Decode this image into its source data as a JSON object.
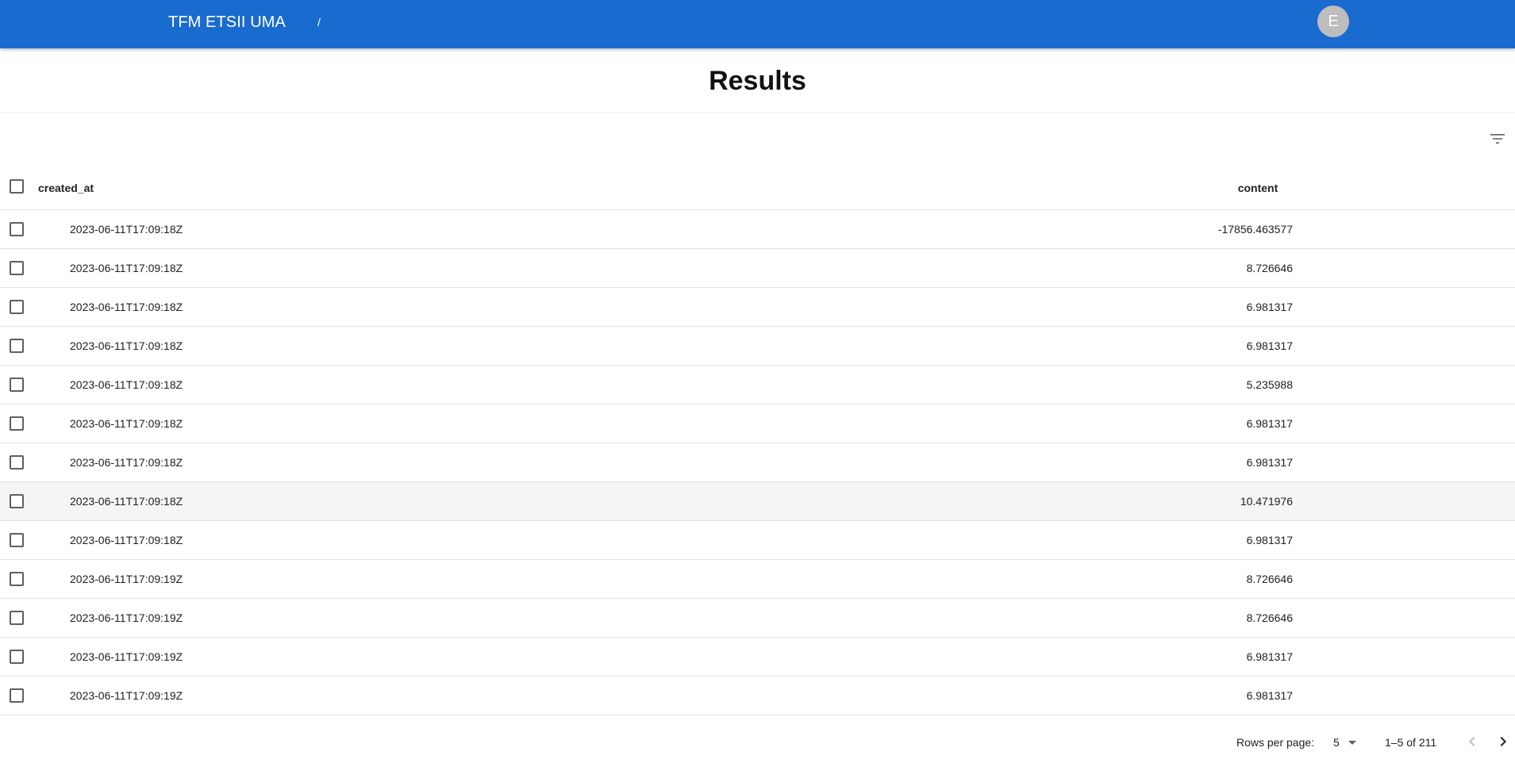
{
  "appbar": {
    "title": "TFM ETSII UMA",
    "breadcrumb_separator": "/",
    "avatar_initial": "E",
    "color": "#1a6bcf"
  },
  "page": {
    "title": "Results"
  },
  "table": {
    "columns": [
      "created_at",
      "content"
    ],
    "rows": [
      {
        "created_at": "2023-06-11T17:09:18Z",
        "content": "-17856.463577"
      },
      {
        "created_at": "2023-06-11T17:09:18Z",
        "content": "8.726646"
      },
      {
        "created_at": "2023-06-11T17:09:18Z",
        "content": "6.981317"
      },
      {
        "created_at": "2023-06-11T17:09:18Z",
        "content": "6.981317"
      },
      {
        "created_at": "2023-06-11T17:09:18Z",
        "content": "5.235988"
      },
      {
        "created_at": "2023-06-11T17:09:18Z",
        "content": "6.981317"
      },
      {
        "created_at": "2023-06-11T17:09:18Z",
        "content": "6.981317"
      },
      {
        "created_at": "2023-06-11T17:09:18Z",
        "content": "10.471976"
      },
      {
        "created_at": "2023-06-11T17:09:18Z",
        "content": "6.981317"
      },
      {
        "created_at": "2023-06-11T17:09:19Z",
        "content": "8.726646"
      },
      {
        "created_at": "2023-06-11T17:09:19Z",
        "content": "8.726646"
      },
      {
        "created_at": "2023-06-11T17:09:19Z",
        "content": "6.981317"
      },
      {
        "created_at": "2023-06-11T17:09:19Z",
        "content": "6.981317"
      }
    ]
  },
  "pagination": {
    "rows_per_page_label": "Rows per page:",
    "rows_per_page_value": "5",
    "range_label": "1–5 of 211"
  },
  "icons": {
    "filter": "filter-list-icon",
    "dropdown": "arrow-drop-down-icon",
    "prev": "chevron-left-icon",
    "next": "chevron-right-icon"
  }
}
